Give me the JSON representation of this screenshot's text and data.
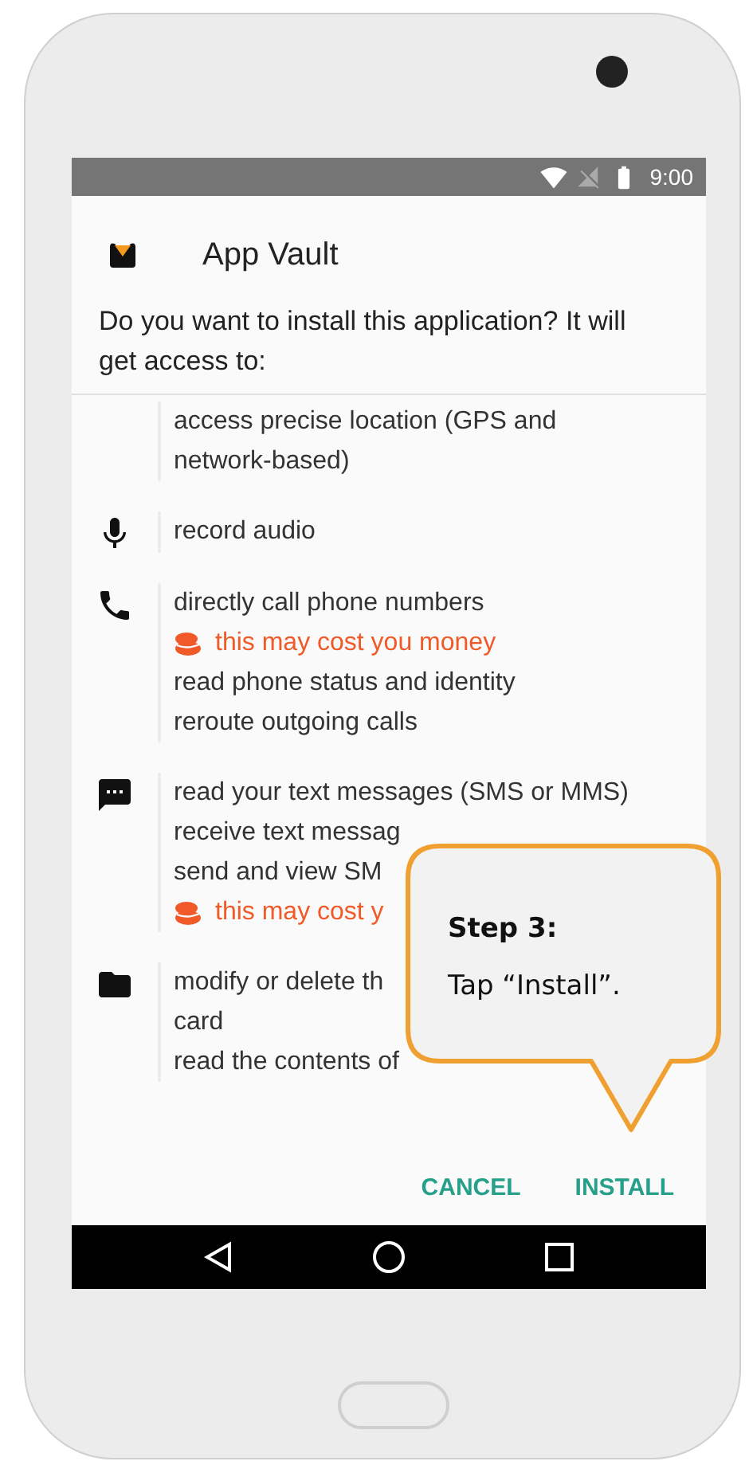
{
  "status_bar": {
    "time": "9:00"
  },
  "dialog": {
    "app_name": "App Vault",
    "question": "Do you want to install this application? It will get access to:",
    "permissions": [
      {
        "kind": "none",
        "lines": [
          {
            "kind": "normal",
            "text": "access precise location (GPS and network-based)"
          }
        ]
      },
      {
        "kind": "mic",
        "lines": [
          {
            "kind": "normal",
            "text": "record audio"
          }
        ]
      },
      {
        "kind": "phone",
        "lines": [
          {
            "kind": "normal",
            "text": "directly call phone numbers"
          },
          {
            "kind": "cost",
            "text": "this may cost you money"
          },
          {
            "kind": "normal",
            "text": "read phone status and identity"
          },
          {
            "kind": "normal",
            "text": "reroute outgoing calls"
          }
        ]
      },
      {
        "kind": "message",
        "lines": [
          {
            "kind": "normal",
            "text": "read your text messages (SMS or MMS)"
          },
          {
            "kind": "normal",
            "text": "receive text messag"
          },
          {
            "kind": "normal",
            "text": "send and view SM"
          },
          {
            "kind": "cost",
            "text": "this may cost y"
          }
        ]
      },
      {
        "kind": "folder",
        "lines": [
          {
            "kind": "normal",
            "text": "modify or delete th"
          },
          {
            "kind": "normal",
            "text": "card"
          },
          {
            "kind": "normal",
            "text": "read the contents of"
          }
        ]
      }
    ],
    "buttons": [
      {
        "label": "CANCEL"
      },
      {
        "label": "INSTALL"
      }
    ]
  },
  "callout": {
    "title": "Step 3:",
    "text": "Tap “Install”."
  }
}
